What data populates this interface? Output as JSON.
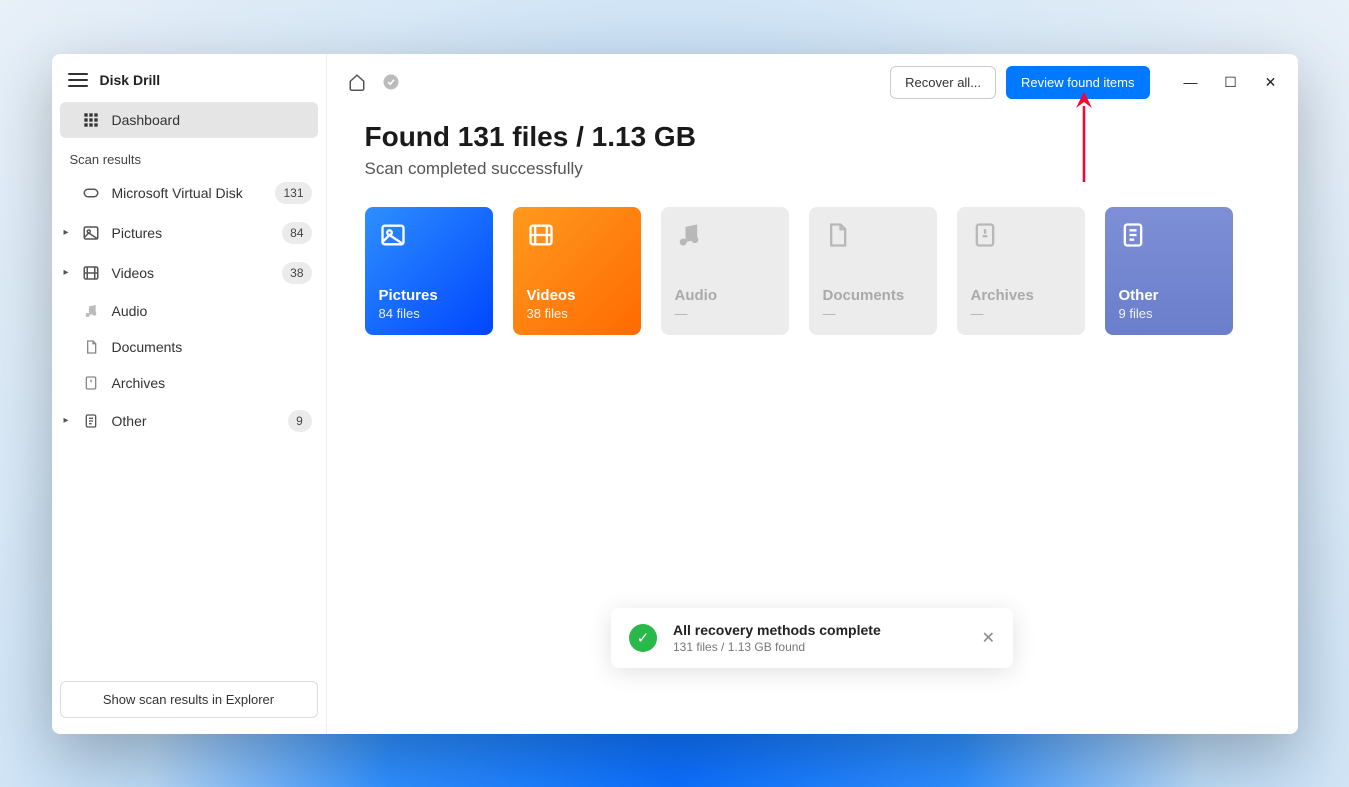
{
  "app": {
    "title": "Disk Drill"
  },
  "sidebar": {
    "dashboard": "Dashboard",
    "section_label": "Scan results",
    "items": [
      {
        "label": "Microsoft Virtual Disk",
        "count": "131"
      },
      {
        "label": "Pictures",
        "count": "84"
      },
      {
        "label": "Videos",
        "count": "38"
      },
      {
        "label": "Audio",
        "count": ""
      },
      {
        "label": "Documents",
        "count": ""
      },
      {
        "label": "Archives",
        "count": ""
      },
      {
        "label": "Other",
        "count": "9"
      }
    ],
    "footer_button": "Show scan results in Explorer"
  },
  "topbar": {
    "recover_all": "Recover all...",
    "review": "Review found items"
  },
  "main": {
    "headline": "Found 131 files / 1.13 GB",
    "subhead": "Scan completed successfully"
  },
  "cards": [
    {
      "name": "Pictures",
      "count": "84 files"
    },
    {
      "name": "Videos",
      "count": "38 files"
    },
    {
      "name": "Audio",
      "count": "—"
    },
    {
      "name": "Documents",
      "count": "—"
    },
    {
      "name": "Archives",
      "count": "—"
    },
    {
      "name": "Other",
      "count": "9 files"
    }
  ],
  "toast": {
    "title": "All recovery methods complete",
    "sub": "131 files / 1.13 GB found"
  }
}
